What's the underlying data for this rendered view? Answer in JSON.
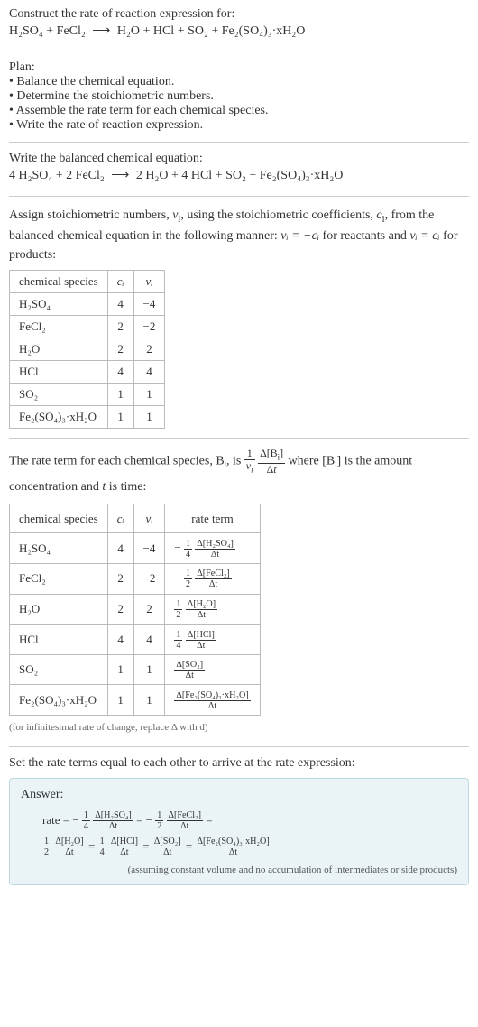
{
  "problem": {
    "title": "Construct the rate of reaction expression for:",
    "eq_reactants": "H₂SO₄ + FeCl₂",
    "eq_products": "H₂O + HCl + SO₂ + Fe₂(SO₄)₃·xH₂O"
  },
  "plan": {
    "label": "Plan:",
    "items": [
      "• Balance the chemical equation.",
      "• Determine the stoichiometric numbers.",
      "• Assemble the rate term for each chemical species.",
      "• Write the rate of reaction expression."
    ]
  },
  "balanced": {
    "label": "Write the balanced chemical equation:",
    "eq_reactants": "4 H₂SO₄ + 2 FeCl₂",
    "eq_products": "2 H₂O + 4 HCl + SO₂ + Fe₂(SO₄)₃·xH₂O"
  },
  "stoich": {
    "intro_pre": "Assign stoichiometric numbers, ",
    "intro_mid1": ", using the stoichiometric coefficients, ",
    "intro_mid2": ", from the balanced chemical equation in the following manner: ",
    "react_rule": "νᵢ = −cᵢ",
    "intro_mid3": " for reactants and ",
    "prod_rule": "νᵢ = cᵢ",
    "intro_post": " for products:",
    "headers": {
      "species": "chemical species",
      "c": "cᵢ",
      "v": "νᵢ"
    },
    "rows": [
      {
        "species": "H₂SO₄",
        "c": "4",
        "v": "−4"
      },
      {
        "species": "FeCl₂",
        "c": "2",
        "v": "−2"
      },
      {
        "species": "H₂O",
        "c": "2",
        "v": "2"
      },
      {
        "species": "HCl",
        "c": "4",
        "v": "4"
      },
      {
        "species": "SO₂",
        "c": "1",
        "v": "1"
      },
      {
        "species": "Fe₂(SO₄)₃·xH₂O",
        "c": "1",
        "v": "1"
      }
    ]
  },
  "rateterm": {
    "intro_pre": "The rate term for each chemical species, Bᵢ, is ",
    "intro_mid": " where [Bᵢ] is the amount concentration and ",
    "intro_post": " is time:",
    "t_label": "t",
    "headers": {
      "species": "chemical species",
      "c": "cᵢ",
      "v": "νᵢ",
      "rate": "rate term"
    },
    "rows": [
      {
        "species": "H₂SO₄",
        "c": "4",
        "v": "−4",
        "sign": "−",
        "coef_num": "1",
        "coef_den": "4",
        "d_num": "Δ[H₂SO₄]",
        "d_den": "Δt"
      },
      {
        "species": "FeCl₂",
        "c": "2",
        "v": "−2",
        "sign": "−",
        "coef_num": "1",
        "coef_den": "2",
        "d_num": "Δ[FeCl₂]",
        "d_den": "Δt"
      },
      {
        "species": "H₂O",
        "c": "2",
        "v": "2",
        "sign": "",
        "coef_num": "1",
        "coef_den": "2",
        "d_num": "Δ[H₂O]",
        "d_den": "Δt"
      },
      {
        "species": "HCl",
        "c": "4",
        "v": "4",
        "sign": "",
        "coef_num": "1",
        "coef_den": "4",
        "d_num": "Δ[HCl]",
        "d_den": "Δt"
      },
      {
        "species": "SO₂",
        "c": "1",
        "v": "1",
        "sign": "",
        "coef_num": "",
        "coef_den": "",
        "d_num": "Δ[SO₂]",
        "d_den": "Δt"
      },
      {
        "species": "Fe₂(SO₄)₃·xH₂O",
        "c": "1",
        "v": "1",
        "sign": "",
        "coef_num": "",
        "coef_den": "",
        "d_num": "Δ[Fe₂(SO₄)₃·xH₂O]",
        "d_den": "Δt"
      }
    ],
    "footnote": "(for infinitesimal rate of change, replace Δ with d)"
  },
  "setequal": "Set the rate terms equal to each other to arrive at the rate expression:",
  "answer": {
    "label": "Answer:",
    "rate_prefix": "rate = ",
    "note": "(assuming constant volume and no accumulation of intermediates or side products)"
  },
  "chart_data": {
    "type": "table",
    "tables": [
      {
        "title": "Stoichiometric numbers",
        "columns": [
          "chemical species",
          "cᵢ",
          "νᵢ"
        ],
        "rows": [
          [
            "H₂SO₄",
            4,
            -4
          ],
          [
            "FeCl₂",
            2,
            -2
          ],
          [
            "H₂O",
            2,
            2
          ],
          [
            "HCl",
            4,
            4
          ],
          [
            "SO₂",
            1,
            1
          ],
          [
            "Fe₂(SO₄)₃·xH₂O",
            1,
            1
          ]
        ]
      },
      {
        "title": "Rate terms",
        "columns": [
          "chemical species",
          "cᵢ",
          "νᵢ",
          "rate term"
        ],
        "rows": [
          [
            "H₂SO₄",
            4,
            -4,
            "−(1/4) Δ[H₂SO₄]/Δt"
          ],
          [
            "FeCl₂",
            2,
            -2,
            "−(1/2) Δ[FeCl₂]/Δt"
          ],
          [
            "H₂O",
            2,
            2,
            "(1/2) Δ[H₂O]/Δt"
          ],
          [
            "HCl",
            4,
            4,
            "(1/4) Δ[HCl]/Δt"
          ],
          [
            "SO₂",
            1,
            1,
            "Δ[SO₂]/Δt"
          ],
          [
            "Fe₂(SO₄)₃·xH₂O",
            1,
            1,
            "Δ[Fe₂(SO₄)₃·xH₂O]/Δt"
          ]
        ]
      }
    ]
  }
}
